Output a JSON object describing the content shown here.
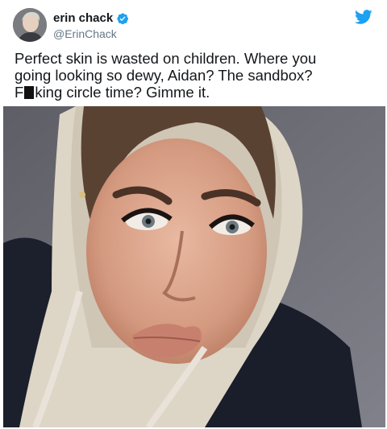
{
  "author": {
    "display_name": "erin chack",
    "handle": "@ErinChack",
    "verified": true,
    "avatar_icon": "avatar-photo"
  },
  "brand": {
    "icon": "twitter-bird-icon",
    "color": "#1da1f2"
  },
  "tweet": {
    "line1": "Perfect skin is wasted on children. Where you",
    "line2": "going looking so dewy, Aidan? The sandbox?",
    "line3_prefix": "F",
    "line3_suffix": "king circle time? Gimme it."
  },
  "media": {
    "type": "photo",
    "icon": "selfie-photo"
  },
  "colors": {
    "verified": "#1da1f2",
    "text": "#14171a",
    "secondary": "#657786"
  }
}
